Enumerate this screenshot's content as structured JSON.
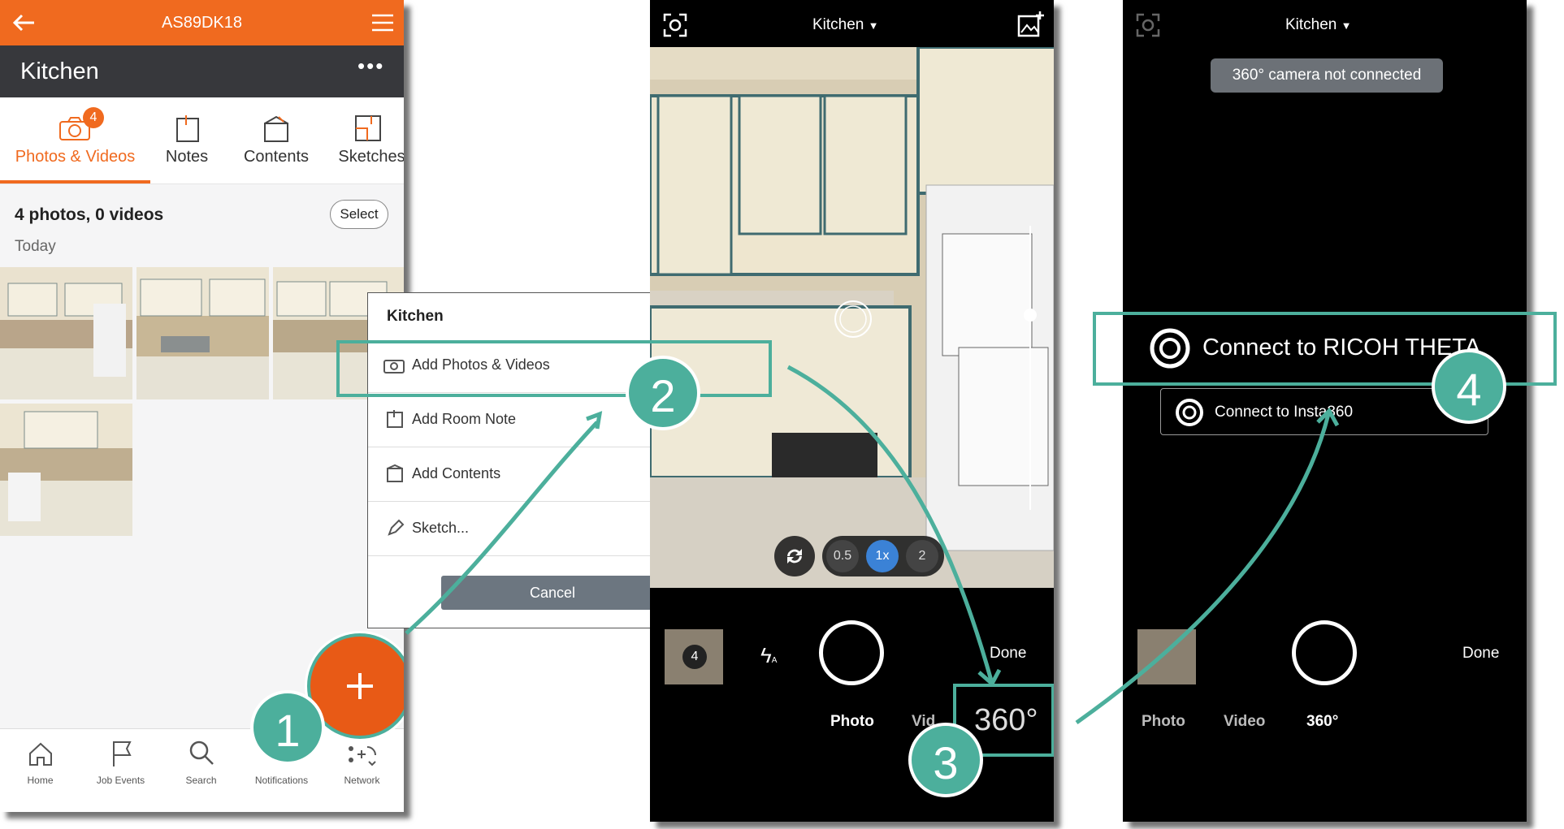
{
  "panel1": {
    "topbar": {
      "title": "AS89DK18"
    },
    "roombar": {
      "title": "Kitchen"
    },
    "tabs": [
      {
        "label": "Photos & Videos",
        "badge": "4"
      },
      {
        "label": "Notes"
      },
      {
        "label": "Contents"
      },
      {
        "label": "Sketches"
      }
    ],
    "summary": "4 photos, 0 videos",
    "select_label": "Select",
    "group_label": "Today",
    "bottom_nav": [
      {
        "label": "Home",
        "icon": "home-icon"
      },
      {
        "label": "Job Events",
        "icon": "flag-icon"
      },
      {
        "label": "Search",
        "icon": "search-icon"
      },
      {
        "label": "Notifications",
        "icon": "bell-icon"
      },
      {
        "label": "Network",
        "icon": "network-icon"
      }
    ],
    "fab_icon": "plus-icon"
  },
  "menu": {
    "title": "Kitchen",
    "items": [
      {
        "label": "Add Photos & Videos",
        "icon": "camera-icon"
      },
      {
        "label": "Add Room Note",
        "icon": "note-icon"
      },
      {
        "label": "Add Contents",
        "icon": "box-icon"
      },
      {
        "label": "Sketch...",
        "icon": "pen-icon"
      }
    ],
    "cancel_label": "Cancel"
  },
  "camera1": {
    "room": "Kitchen",
    "zoom": [
      "0.5",
      "1x",
      "2"
    ],
    "count": "4",
    "done": "Done",
    "modes": [
      "Photo",
      "Vid",
      "360°"
    ]
  },
  "camera2": {
    "room": "Kitchen",
    "status": "360° camera not connected",
    "connect_ricoh": "Connect to RICOH THETA",
    "connect_insta": "Connect to Insta360",
    "done": "Done",
    "modes": [
      "Photo",
      "Video",
      "360°"
    ]
  },
  "steps": [
    "1",
    "2",
    "3",
    "4"
  ],
  "colors": {
    "brand": "#f06a1f",
    "dark": "#37383c",
    "teal": "#4caf9c",
    "zoom_active": "#3b82d6"
  }
}
